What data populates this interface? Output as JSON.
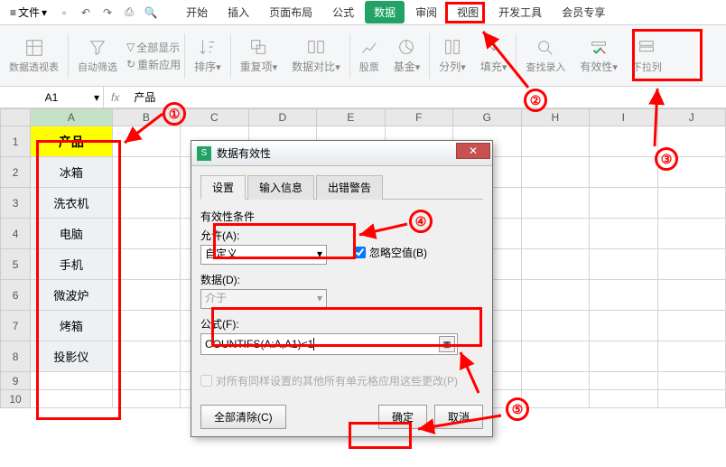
{
  "menubar": {
    "file_label": "文件",
    "file_icon": "≡"
  },
  "tabs": [
    "开始",
    "插入",
    "页面布局",
    "公式",
    "数据",
    "审阅",
    "视图",
    "开发工具",
    "会员专享"
  ],
  "active_tab": 4,
  "ribbon": {
    "pivot": "数据透视表",
    "filter": "自动筛选",
    "showall": "全部显示",
    "reapply": "重新应用",
    "sort": "排序",
    "dedup": "重复项",
    "compare": "数据对比",
    "stock": "股票",
    "fund": "基金",
    "split": "分列",
    "fill": "填充",
    "find": "查找录入",
    "validity": "有效性",
    "dropdown": "下拉列"
  },
  "namebox": "A1",
  "fx_value": "产品",
  "cols": [
    "A",
    "B",
    "C",
    "D",
    "E",
    "F",
    "G",
    "H",
    "I",
    "J"
  ],
  "rows": [
    "1",
    "2",
    "3",
    "4",
    "5",
    "6",
    "7",
    "8",
    "9",
    "10"
  ],
  "colA": {
    "header": "产品",
    "data": [
      "冰箱",
      "洗衣机",
      "电脑",
      "手机",
      "微波炉",
      "烤箱",
      "投影仪"
    ]
  },
  "dialog": {
    "title": "数据有效性",
    "tabs": [
      "设置",
      "输入信息",
      "出错警告"
    ],
    "legend": "有效性条件",
    "allow_label": "允许(A):",
    "allow_value": "自定义",
    "ignore_blank": "忽略空值(B)",
    "data_label": "数据(D):",
    "data_value": "介于",
    "formula_label": "公式(F):",
    "formula_value": "COUNTIFS(A:A,A1)<1",
    "applyall": "对所有同样设置的其他所有单元格应用这些更改(P)",
    "clear": "全部清除(C)",
    "ok": "确定",
    "cancel": "取消"
  },
  "annot": {
    "n1": "①",
    "n2": "②",
    "n3": "③",
    "n4": "④",
    "n5": "⑤"
  }
}
